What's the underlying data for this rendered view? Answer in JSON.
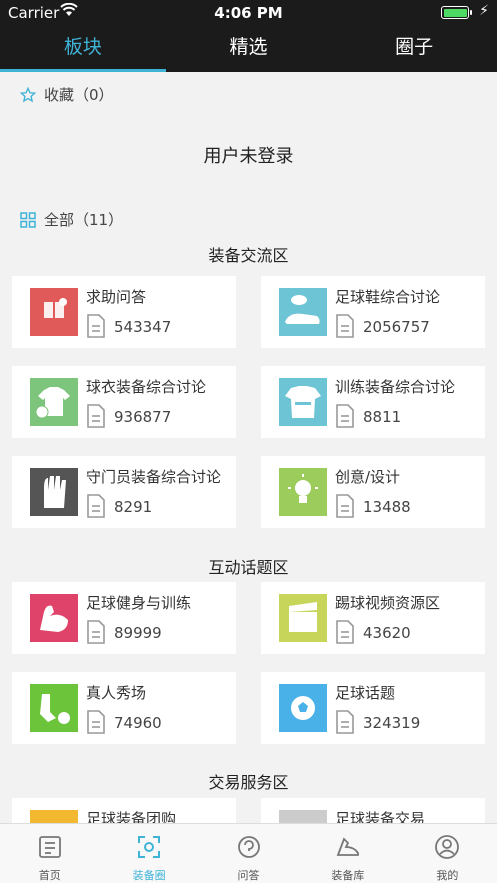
{
  "status": {
    "carrier": "Carrier",
    "time": "4:06 PM"
  },
  "tabs": [
    {
      "label": "板块",
      "active": true
    },
    {
      "label": "精选",
      "active": false
    },
    {
      "label": "圈子",
      "active": false
    }
  ],
  "favorites": {
    "label": "收藏",
    "count": "（0）"
  },
  "login_notice": "用户未登录",
  "all": {
    "label": "全部",
    "count": "（11）"
  },
  "sections": [
    {
      "title": "装备交流区"
    },
    {
      "title": "互动话题区"
    },
    {
      "title": "交易服务区"
    }
  ],
  "cards": [
    {
      "title": "求助问答",
      "count": "543347",
      "color": "#e05a5a"
    },
    {
      "title": "足球鞋综合讨论",
      "count": "2056757",
      "color": "#6cc4d4"
    },
    {
      "title": "球衣装备综合讨论",
      "count": "936877",
      "color": "#7dc47d"
    },
    {
      "title": "训练装备综合讨论",
      "count": "8811",
      "color": "#6cc4d4"
    },
    {
      "title": "守门员装备综合讨论",
      "count": "8291",
      "color": "#555555"
    },
    {
      "title": "创意/设计",
      "count": "13488",
      "color": "#9ccc5c"
    },
    {
      "title": "足球健身与训练",
      "count": "89999",
      "color": "#e0436a"
    },
    {
      "title": "踢球视频资源区",
      "count": "43620",
      "color": "#c7d65a"
    },
    {
      "title": "真人秀场",
      "count": "74960",
      "color": "#6cc43a"
    },
    {
      "title": "足球话题",
      "count": "324319",
      "color": "#4ab0e8"
    },
    {
      "title": "足球装备团购",
      "count": "",
      "color": "#f2b830"
    },
    {
      "title": "足球装备交易",
      "count": "",
      "color": "#cccccc"
    }
  ],
  "bottom_nav": [
    {
      "label": "首页",
      "icon": "home-icon"
    },
    {
      "label": "装备圈",
      "icon": "gear-circle-icon"
    },
    {
      "label": "问答",
      "icon": "qa-icon"
    },
    {
      "label": "装备库",
      "icon": "shoe-icon"
    },
    {
      "label": "我的",
      "icon": "profile-icon"
    }
  ],
  "colors": {
    "accent": "#3fb3d6",
    "topbar": "#1b1b1b"
  }
}
